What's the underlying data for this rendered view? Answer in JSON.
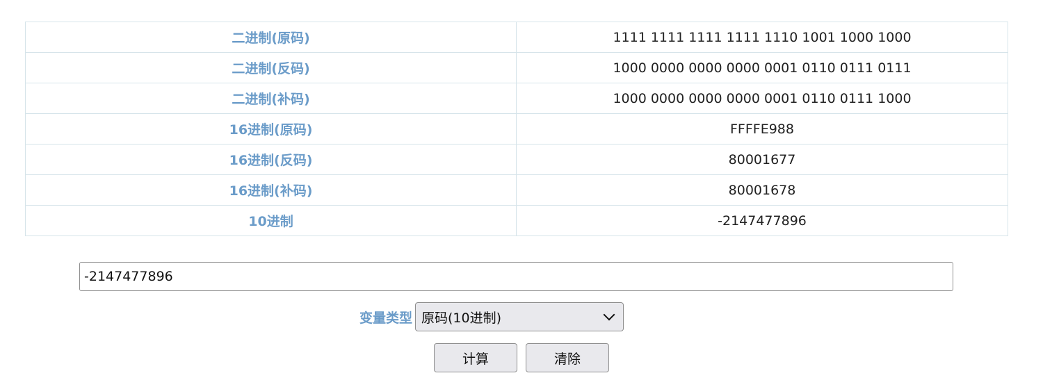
{
  "result_table": {
    "rows": [
      {
        "label": "二进制(原码)",
        "value": "1111 1111 1111 1111 1110 1001 1000 1000"
      },
      {
        "label": "二进制(反码)",
        "value": "1000 0000 0000 0000 0001 0110 0111 0111"
      },
      {
        "label": "二进制(补码)",
        "value": "1000 0000 0000 0000 0001 0110 0111 1000"
      },
      {
        "label": "16进制(原码)",
        "value": "FFFFE988"
      },
      {
        "label": "16进制(反码)",
        "value": "80001677"
      },
      {
        "label": "16进制(补码)",
        "value": "80001678"
      },
      {
        "label": "10进制",
        "value": "-2147477896"
      }
    ]
  },
  "input": {
    "value": "-2147477896"
  },
  "variable_type": {
    "label": "变量类型",
    "selected": "原码(10进制)"
  },
  "buttons": {
    "calculate": "计算",
    "clear": "清除"
  },
  "colors": {
    "label_blue": "#6b9cc9",
    "border": "#d6e4ea",
    "button_bg": "#e9e9ed"
  }
}
